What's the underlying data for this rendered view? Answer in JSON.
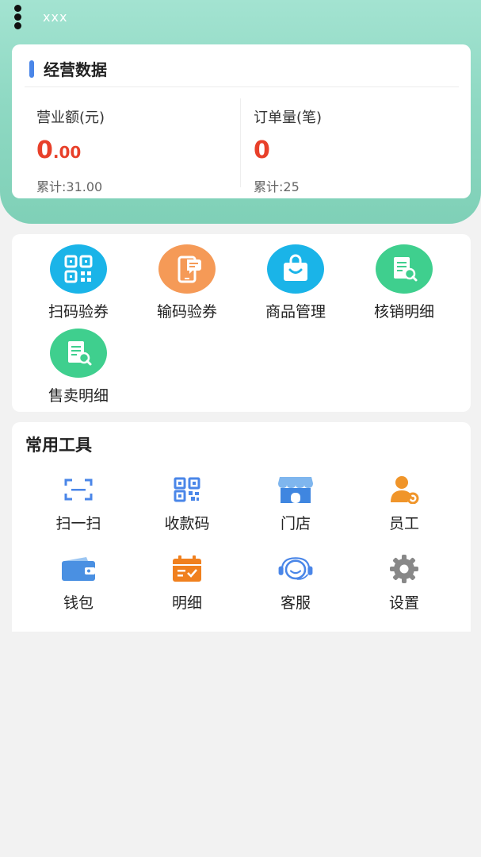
{
  "header": {
    "title": "xxx",
    "colors": {
      "gradient_top": "#a3e3d1",
      "gradient_bottom": "#7fd0b7"
    }
  },
  "stats": {
    "title": "经营数据",
    "accent_color": "#4a86e8",
    "revenue": {
      "label": "营业额(元)",
      "value_int": "0",
      "value_dec": ".00",
      "total": "累计:31.00"
    },
    "orders": {
      "label": "订单量(笔)",
      "value": "0",
      "total": "累计:25"
    },
    "value_color": "#e8402a"
  },
  "functions": [
    {
      "label": "扫码验券",
      "icon": "qr-scan-icon",
      "color": "#1ab4e8"
    },
    {
      "label": "输码验券",
      "icon": "phone-message-icon",
      "color": "#f59a57"
    },
    {
      "label": "商品管理",
      "icon": "shopping-bag-icon",
      "color": "#1ab4e8"
    },
    {
      "label": "核销明细",
      "icon": "document-search-icon",
      "color": "#3fcf8e"
    },
    {
      "label": "售卖明细",
      "icon": "document-search-icon",
      "color": "#3fcf8e"
    }
  ],
  "tools": {
    "title": "常用工具",
    "items": [
      {
        "label": "扫一扫",
        "icon": "scan-icon",
        "color": "#4a86e8"
      },
      {
        "label": "收款码",
        "icon": "qr-code-icon",
        "color": "#4a86e8"
      },
      {
        "label": "门店",
        "icon": "store-icon",
        "color": "#4a90e2"
      },
      {
        "label": "员工",
        "icon": "employee-icon",
        "color": "#f0952a"
      },
      {
        "label": "钱包",
        "icon": "wallet-icon",
        "color": "#4a90e2"
      },
      {
        "label": "明细",
        "icon": "calendar-detail-icon",
        "color": "#f0801e"
      },
      {
        "label": "客服",
        "icon": "customer-service-icon",
        "color": "#4a86e8"
      },
      {
        "label": "设置",
        "icon": "gear-icon",
        "color": "#888888"
      }
    ]
  }
}
